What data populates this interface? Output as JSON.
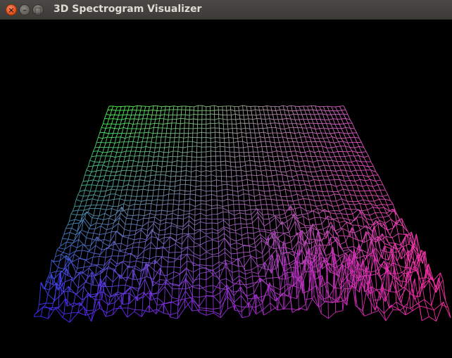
{
  "window": {
    "title": "3D Spectrogram Visualizer",
    "controls": {
      "close_glyph": "×",
      "minimize_glyph": "–",
      "maximize_glyph": "□"
    }
  },
  "viewport": {
    "background": "#000000",
    "mesh_colors": {
      "back_left": "#4dff4d",
      "back_right": "#d65cc8",
      "front_left": "#3b2aff",
      "front_right": "#ff2aa0"
    }
  }
}
